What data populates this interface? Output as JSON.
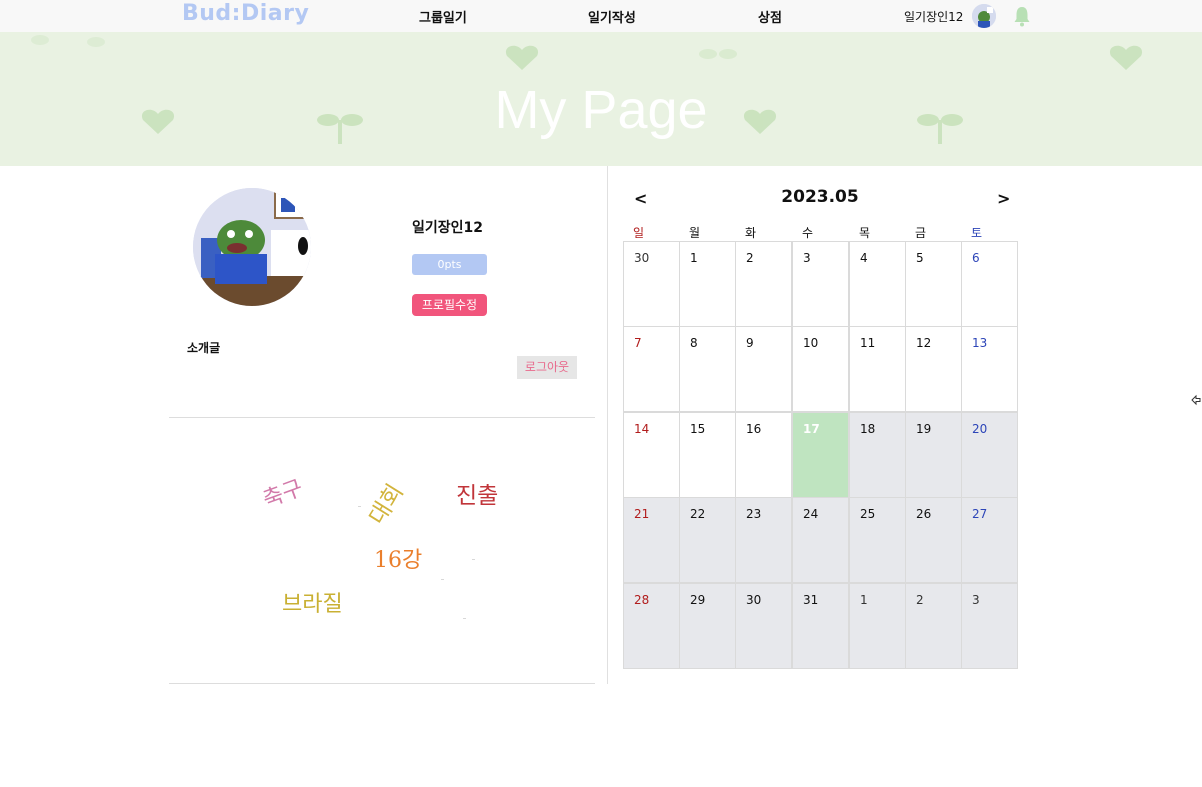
{
  "nav": {
    "logo": "Bud:Diary",
    "links": [
      "그룹일기",
      "일기작성",
      "상점"
    ],
    "username": "일기장인12"
  },
  "banner": {
    "title": "My Page"
  },
  "profile": {
    "username": "일기장인12",
    "points": "0pts",
    "edit_label": "프로필수정",
    "intro_label": "소개글",
    "logout_label": "로그아웃"
  },
  "wordcloud": {
    "words": [
      "축구",
      "대회",
      "진출",
      "16강",
      "브라질"
    ],
    "colors": [
      "#d27aaa",
      "#d2b43c",
      "#c1353a",
      "#ea7f2c",
      "#c9b033"
    ]
  },
  "calendar": {
    "prev": "<",
    "next": ">",
    "title": "2023.05",
    "weekdays": [
      "일",
      "월",
      "화",
      "수",
      "목",
      "금",
      "토"
    ],
    "weeks": [
      [
        "30",
        "1",
        "2",
        "3",
        "4",
        "5",
        "6"
      ],
      [
        "7",
        "8",
        "9",
        "10",
        "11",
        "12",
        "13"
      ],
      [
        "14",
        "15",
        "16",
        "17",
        "18",
        "19",
        "20"
      ],
      [
        "21",
        "22",
        "23",
        "24",
        "25",
        "26",
        "27"
      ],
      [
        "28",
        "29",
        "30",
        "31",
        "1",
        "2",
        "3"
      ]
    ],
    "today": "17",
    "colors": {
      "today": "#bfe4c0",
      "future": "#e7e8ec",
      "sunday": "#b11c1c",
      "saturday": "#2d45b8"
    }
  },
  "colors": {
    "accent": "#b3c8f3",
    "edit_button": "#f1557c",
    "banner": "#e9f2e2"
  }
}
